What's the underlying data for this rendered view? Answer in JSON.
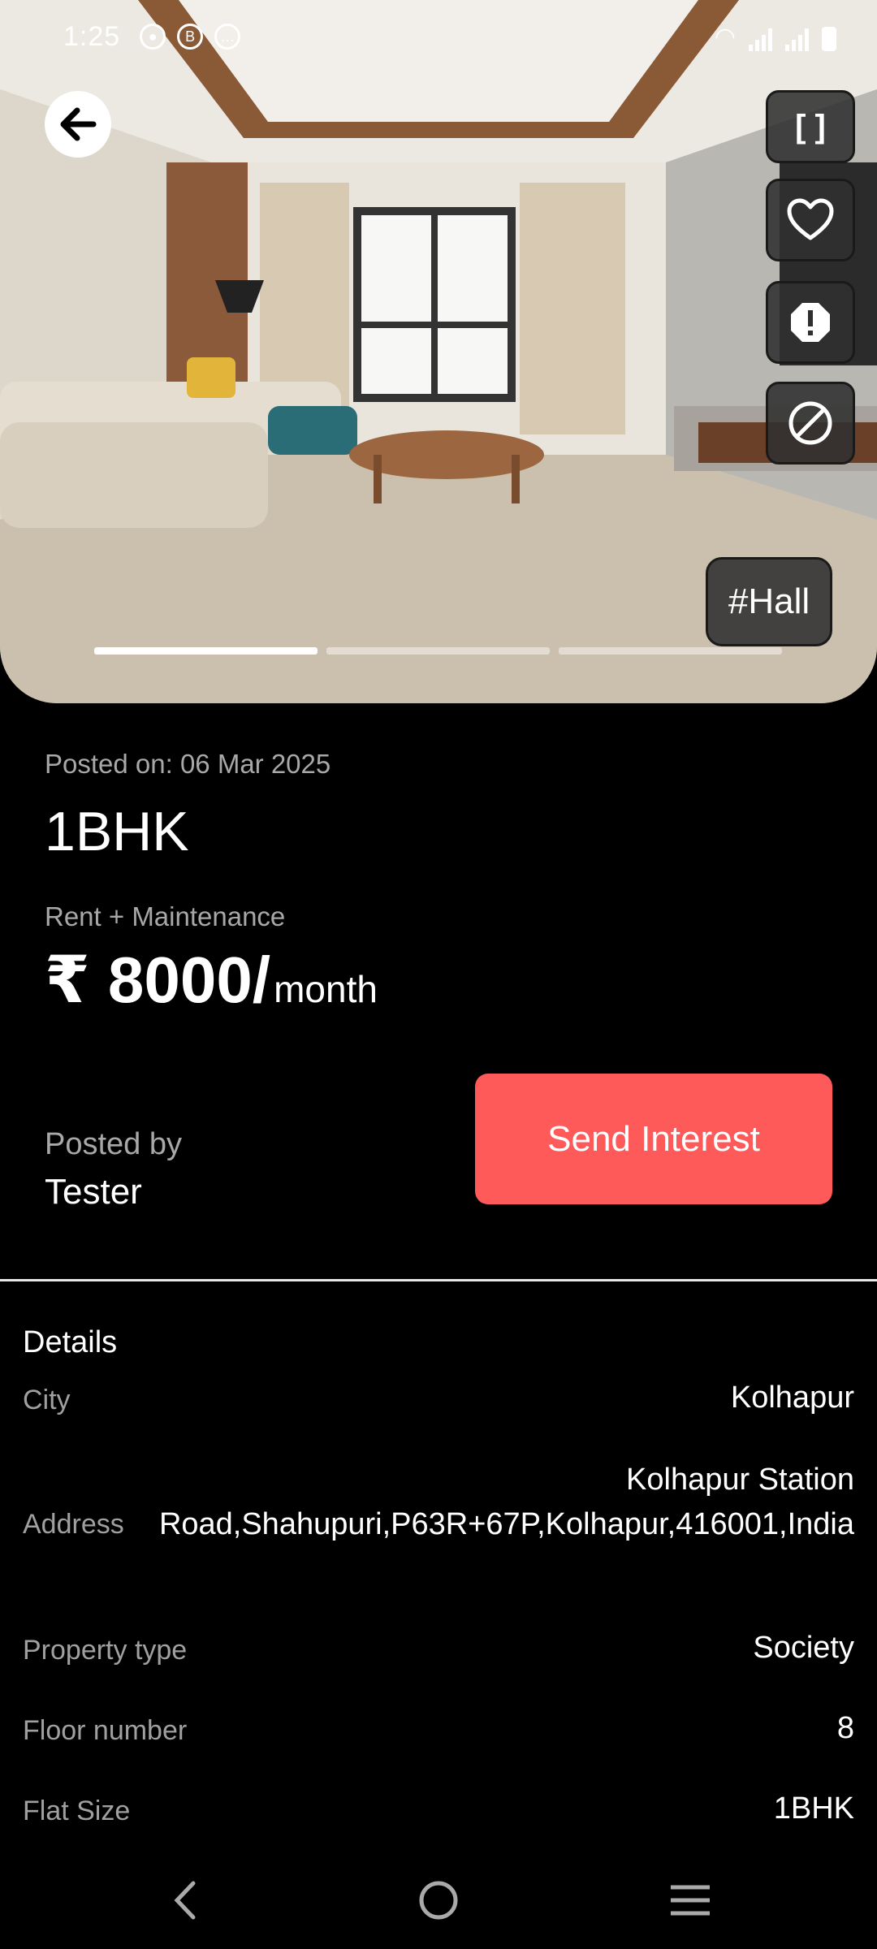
{
  "status_bar": {
    "time": "1:25",
    "notifications": [
      "chat-bubble-icon",
      "b-circle-icon",
      "message-icon"
    ],
    "system_icons": [
      "call-wifi-icon",
      "volte-icon",
      "wifi-icon",
      "signal-icon",
      "signal-icon-2",
      "battery-icon"
    ]
  },
  "gallery": {
    "tag": "#Hall",
    "total_images": 3,
    "active_index": 0,
    "actions": [
      "expand-icon",
      "heart-icon",
      "report-icon",
      "block-icon"
    ],
    "expand_glyph": "[ ]"
  },
  "listing": {
    "posted_on": "Posted on: 06 Mar 2025",
    "title": "1BHK",
    "rent_label": "Rent + Maintenance",
    "price": "₹ 8000/",
    "price_unit": "month",
    "posted_by_label": "Posted by",
    "posted_by_name": "Tester",
    "send_interest_label": "Send Interest"
  },
  "details": {
    "title": "Details",
    "rows": [
      {
        "label": "City",
        "value": "Kolhapur"
      },
      {
        "label": "Address",
        "value_line1": "Kolhapur Station",
        "value_line2": "Road,Shahupuri,P63R+67P,Kolhapur,416001,India"
      },
      {
        "label": "Property type",
        "value": "Society"
      },
      {
        "label": "Floor number",
        "value": "8"
      },
      {
        "label": "Flat Size",
        "value": "1BHK"
      }
    ]
  },
  "nav": [
    "back-nav-icon",
    "home-nav-icon",
    "menu-nav-icon"
  ],
  "colors": {
    "accent": "#ff5a5a",
    "background": "#000000",
    "muted_text": "#a8a8a8"
  }
}
